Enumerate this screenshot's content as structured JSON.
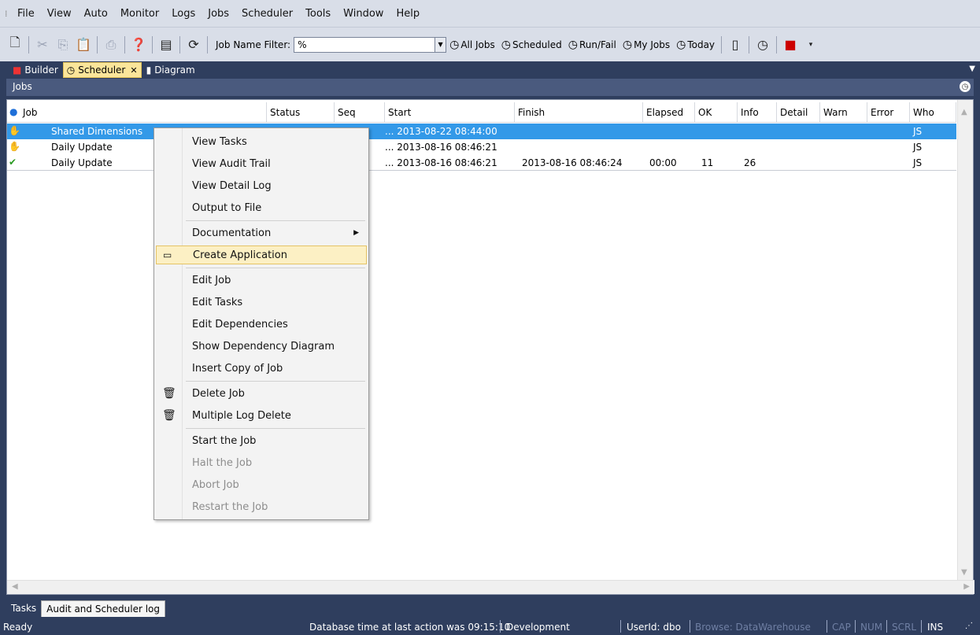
{
  "menubar": {
    "items": [
      "File",
      "View",
      "Auto",
      "Monitor",
      "Logs",
      "Jobs",
      "Scheduler",
      "Tools",
      "Window",
      "Help"
    ]
  },
  "toolbar": {
    "filter_label": "Job Name Filter:",
    "filter_value": "%",
    "filters": [
      "All Jobs",
      "Scheduled",
      "Run/Fail",
      "My Jobs",
      "Today"
    ]
  },
  "doctabs": [
    {
      "label": "Builder",
      "icon": "builder-icon"
    },
    {
      "label": "Scheduler",
      "icon": "clock-icon",
      "active": true
    },
    {
      "label": "Diagram",
      "icon": "diagram-icon"
    }
  ],
  "pane": {
    "title": "Jobs"
  },
  "grid": {
    "columns": [
      "Job",
      "Status",
      "Seq",
      "Start",
      "Finish",
      "Elapsed",
      "OK",
      "Info",
      "Detail",
      "Warn",
      "Error",
      "Who"
    ],
    "rows": [
      {
        "icon": "hand-icon",
        "job": "Shared Dimensions",
        "start": "... 2013-08-22 08:44:00",
        "finish": "",
        "elapsed": "",
        "ok": "",
        "info": "",
        "who": "JS",
        "selected": true
      },
      {
        "icon": "hand-icon",
        "job": "Daily Update",
        "start": "... 2013-08-16 08:46:21",
        "finish": "",
        "elapsed": "",
        "ok": "",
        "info": "",
        "who": "JS"
      },
      {
        "icon": "check-icon",
        "job": "Daily Update",
        "start": "... 2013-08-16 08:46:21",
        "finish": "2013-08-16 08:46:24",
        "elapsed": "00:00",
        "ok": "11",
        "info": "26",
        "who": "JS"
      }
    ]
  },
  "context_menu": {
    "items": [
      {
        "label": "View Tasks"
      },
      {
        "label": "View Audit Trail"
      },
      {
        "label": "View Detail Log"
      },
      {
        "label": "Output to File"
      },
      {
        "label": "Documentation"
      },
      {
        "label": "Create Application"
      },
      {
        "label": "Edit Job"
      },
      {
        "label": "Edit Tasks"
      },
      {
        "label": "Edit Dependencies"
      },
      {
        "label": "Show Dependency Diagram"
      },
      {
        "label": "Insert Copy of Job"
      },
      {
        "label": "Delete Job"
      },
      {
        "label": "Multiple Log Delete"
      },
      {
        "label": "Start the Job"
      },
      {
        "label": "Halt the Job"
      },
      {
        "label": "Abort Job"
      },
      {
        "label": "Restart the Job"
      }
    ]
  },
  "bottom_tabs": [
    "Tasks",
    "Audit and Scheduler log"
  ],
  "status": {
    "ready": "Ready",
    "db_time": "Database time at last action was 09:15:10",
    "env": "Development",
    "user": "UserId: dbo",
    "browse": "Browse: DataWarehouse",
    "cap": "CAP",
    "num": "NUM",
    "scrl": "SCRL",
    "ins": "INS"
  }
}
